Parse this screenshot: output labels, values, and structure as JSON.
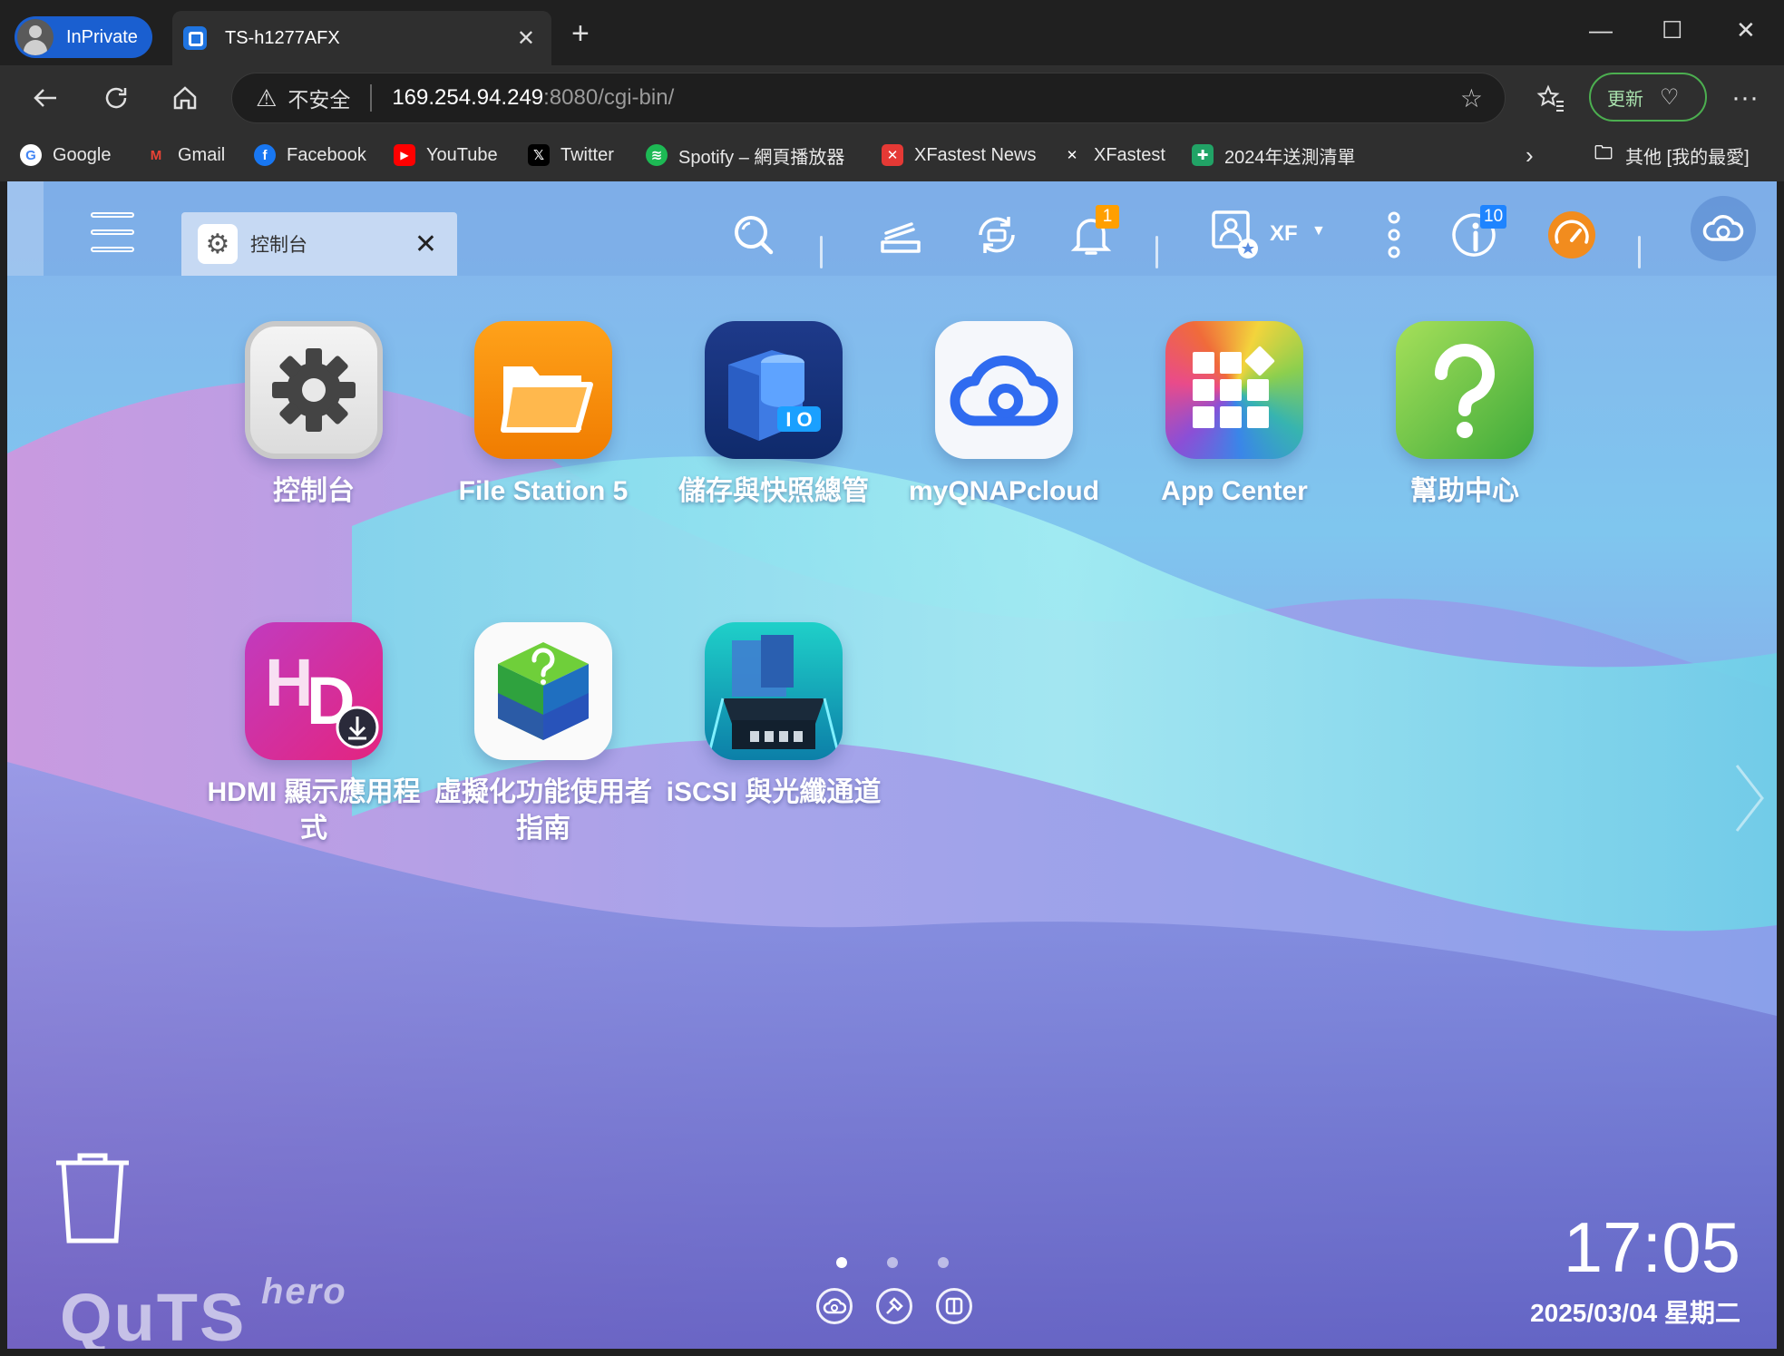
{
  "browser": {
    "inprivate_label": "InPrivate",
    "tab_title": "TS-h1277AFX",
    "new_tab": "+",
    "window_controls": {
      "minimize": "—",
      "maximize": "☐",
      "close": "✕"
    },
    "address": {
      "warning_label": "不安全",
      "host": "169.254.94.249",
      "path": ":8080/cgi-bin/"
    },
    "update_label": "更新",
    "more": "···"
  },
  "bookmarks": {
    "items": [
      {
        "label": "Google",
        "icon": "google-icon",
        "color": "#ffffff"
      },
      {
        "label": "Gmail",
        "icon": "gmail-icon",
        "color": "#ea4335"
      },
      {
        "label": "Facebook",
        "icon": "facebook-icon",
        "color": "#1877f2"
      },
      {
        "label": "YouTube",
        "icon": "youtube-icon",
        "color": "#ff0000"
      },
      {
        "label": "Twitter",
        "icon": "x-icon",
        "color": "#000000"
      },
      {
        "label": "Spotify – 網頁播放器",
        "icon": "spotify-icon",
        "color": "#1db954"
      },
      {
        "label": "XFastest News",
        "icon": "xfastest-icon",
        "color": "#e53935"
      },
      {
        "label": "XFastest",
        "icon": "xfastest-icon",
        "color": "#202020"
      },
      {
        "label": "2024年送測清單",
        "icon": "sheets-icon",
        "color": "#21a366"
      }
    ],
    "other_folder": "其他 [我的最愛]"
  },
  "desktop": {
    "open_tab_label": "控制台",
    "user_label": "XF",
    "notification_count": "1",
    "info_count": "10",
    "apps": [
      {
        "label": "控制台"
      },
      {
        "label": "File Station 5"
      },
      {
        "label": "儲存與快照總管"
      },
      {
        "label": "myQNAPcloud"
      },
      {
        "label": "App Center"
      },
      {
        "label": "幫助中心"
      },
      {
        "label": "HDMI 顯示應用程式"
      },
      {
        "label": "虛擬化功能使用者指南"
      },
      {
        "label": "iSCSI 與光纖通道"
      }
    ],
    "brand": "QuTS",
    "brand_suffix": "hero",
    "time": "17:05",
    "date": "2025/03/04 星期二"
  }
}
